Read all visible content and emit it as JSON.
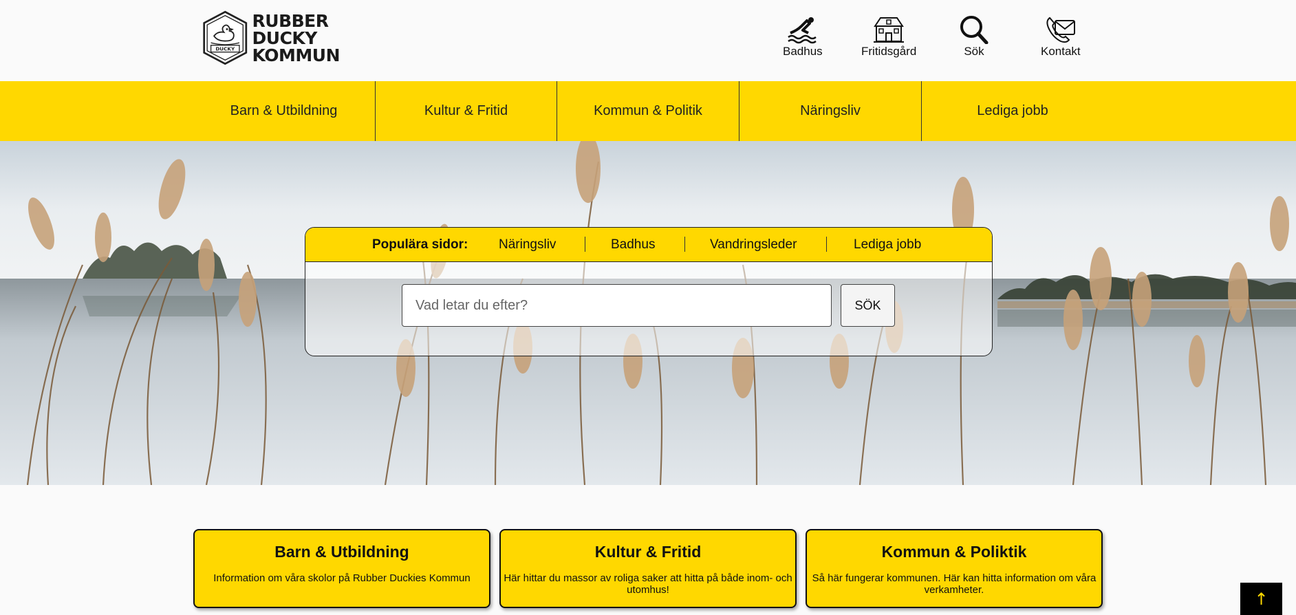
{
  "header": {
    "logo": {
      "lines": [
        "RUBBER",
        "DUCKY",
        "KOMMUN"
      ],
      "badge_text": "DUCKY"
    },
    "quick_links": [
      {
        "label": "Badhus",
        "icon": "swimmer-icon"
      },
      {
        "label": "Fritidsgård",
        "icon": "house-icon"
      },
      {
        "label": "Sök",
        "icon": "search-icon"
      },
      {
        "label": "Kontakt",
        "icon": "phone-mail-icon"
      }
    ]
  },
  "nav": {
    "items": [
      "Barn & Utbildning",
      "Kultur & Fritid",
      "Kommun & Politik",
      "Näringsliv",
      "Lediga jobb"
    ]
  },
  "search": {
    "popular_label": "Populära sidor:",
    "popular_links": [
      "Näringsliv",
      "Badhus",
      "Vandringsleder",
      "Lediga jobb"
    ],
    "placeholder": "Vad letar du efter?",
    "button_label": "SÖK"
  },
  "cards": [
    {
      "title": "Barn & Utbildning",
      "description": "Information om våra skolor på Rubber Duckies Kommun"
    },
    {
      "title": "Kultur & Fritid",
      "description": "Här hittar du massor av roliga saker att hitta på både inom- och utomhus!"
    },
    {
      "title": "Kommun & Poliktik",
      "description": "Så här fungerar kommunen. Här kan hitta information om våra verkamheter."
    }
  ],
  "back_to_top": {
    "label": "↑"
  },
  "colors": {
    "brand_yellow": "#ffd800",
    "border": "#222222",
    "background": "#fafafa"
  }
}
